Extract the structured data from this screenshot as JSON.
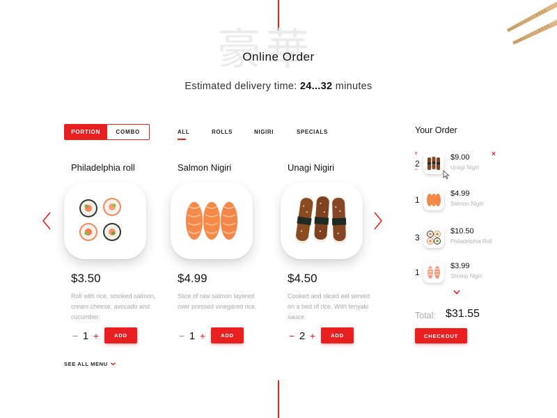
{
  "header": {
    "watermark": "豪華",
    "title": "Online Order",
    "delivery_prefix": "Estimated delivery time:",
    "delivery_range": "24...32",
    "delivery_suffix": "minutes"
  },
  "mode_toggle": {
    "options": [
      "PORTION",
      "COMBO"
    ],
    "selected": "PORTION"
  },
  "filters": {
    "items": [
      "ALL",
      "ROLLS",
      "NIGIRI",
      "SPECIALS"
    ],
    "selected": "ALL"
  },
  "products": [
    {
      "name": "Philadelphia roll",
      "price": "$3.50",
      "description": "Roll with rice, smoked salmon, cream cheese, avocado and cucumber.",
      "qty": "1",
      "add_label": "ADD",
      "icon": "sushi-roll-plate"
    },
    {
      "name": "Salmon Nigiri",
      "price": "$4.99",
      "description": "Slice of raw salmon layered over pressed vinegared rice.",
      "qty": "1",
      "add_label": "ADD",
      "icon": "salmon-nigiri-plate"
    },
    {
      "name": "Unagi Nigiri",
      "price": "$4.50",
      "description": "Cooked and sliced eel served on a bed of rice. With teriyaki sauce.",
      "qty": "2",
      "add_label": "ADD",
      "icon": "unagi-nigiri-plate"
    }
  ],
  "see_all": "SEE ALL MENU",
  "order": {
    "title": "Your Order",
    "items": [
      {
        "qty": "2",
        "price": "$9.00",
        "name": "Unagi Nigiri",
        "plus": "+",
        "minus": "−",
        "remove": "×"
      },
      {
        "qty": "1",
        "price": "$4.99",
        "name": "Salmon Nigiri"
      },
      {
        "qty": "3",
        "price": "$10.50",
        "name": "Philadelphia Roll"
      },
      {
        "qty": "1",
        "price": "$3.99",
        "name": "Shrimp Nigiri"
      }
    ],
    "total_label": "Total:",
    "total": "$31.55",
    "checkout_label": "CHECKOUT"
  },
  "colors": {
    "accent": "#e8201f",
    "text": "#111111",
    "muted": "#a8a8a8"
  },
  "icons": [
    "chopsticks-icon",
    "arrow-left-icon",
    "arrow-right-icon",
    "chevron-down-icon",
    "close-icon",
    "cursor-icon"
  ]
}
